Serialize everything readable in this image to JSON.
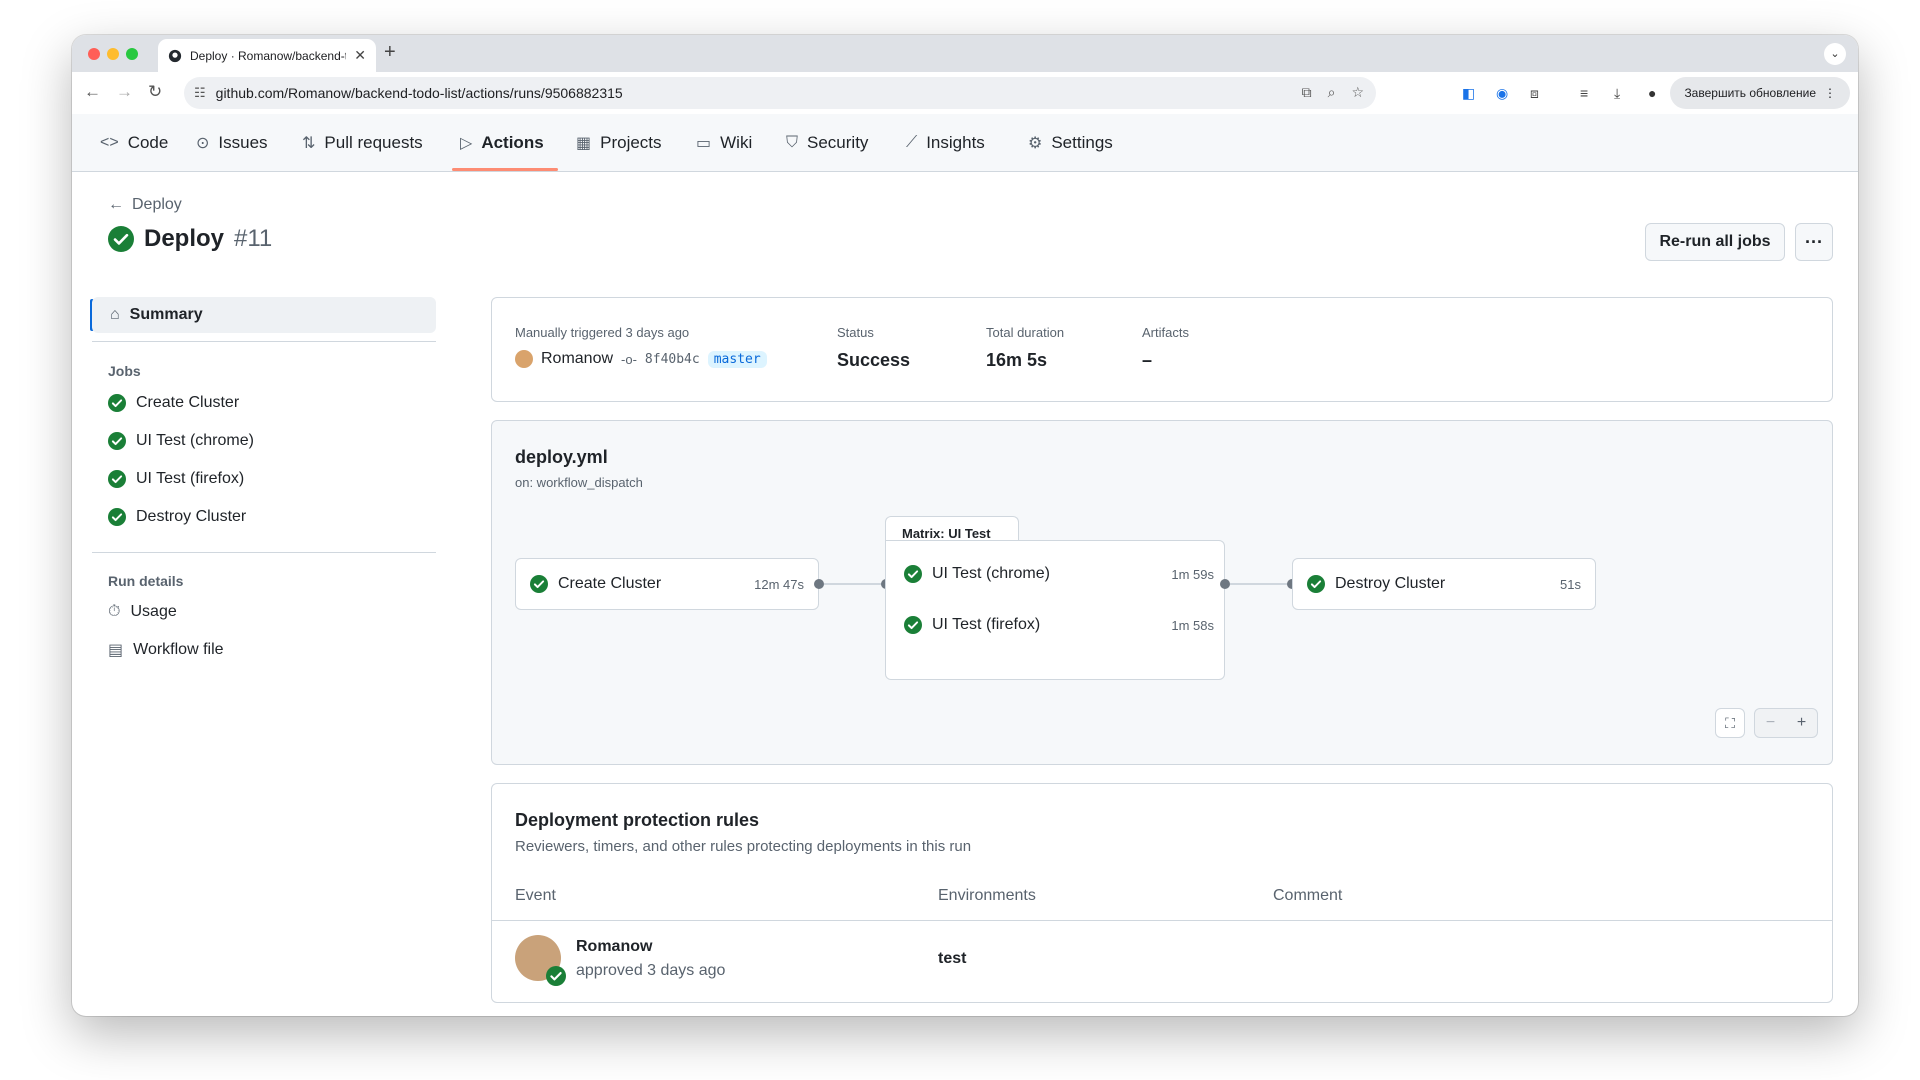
{
  "browser": {
    "tab_title": "Deploy · Romanow/backend-t",
    "url": "github.com/Romanow/backend-todo-list/actions/runs/9506882315",
    "update_button": "Завершить обновление"
  },
  "repo_nav": {
    "tabs": [
      {
        "label": "Code"
      },
      {
        "label": "Issues"
      },
      {
        "label": "Pull requests"
      },
      {
        "label": "Actions"
      },
      {
        "label": "Projects"
      },
      {
        "label": "Wiki"
      },
      {
        "label": "Security"
      },
      {
        "label": "Insights"
      },
      {
        "label": "Settings"
      }
    ],
    "active": "Actions"
  },
  "header": {
    "back_label": "Deploy",
    "title": "Deploy",
    "run_number": "#11",
    "rerun_label": "Re-run all jobs",
    "more_label": "···"
  },
  "sidebar": {
    "summary_label": "Summary",
    "jobs_heading": "Jobs",
    "jobs": [
      "Create Cluster",
      "UI Test (chrome)",
      "UI Test (firefox)",
      "Destroy Cluster"
    ],
    "run_details_heading": "Run details",
    "usage_label": "Usage",
    "workflow_file_label": "Workflow file"
  },
  "summary": {
    "trigger_label": "Manually triggered 3 days ago",
    "user": "Romanow",
    "commit": "8f40b4c",
    "branch": "master",
    "status_label": "Status",
    "status_value": "Success",
    "duration_label": "Total duration",
    "duration_value": "16m 5s",
    "artifacts_label": "Artifacts",
    "artifacts_value": "–"
  },
  "workflow": {
    "file": "deploy.yml",
    "trigger": "on: workflow_dispatch",
    "matrix_label": "Matrix: UI Test",
    "create": {
      "name": "Create Cluster",
      "duration": "12m 47s"
    },
    "chrome": {
      "name": "UI Test (chrome)",
      "duration": "1m 59s"
    },
    "firefox": {
      "name": "UI Test (firefox)",
      "duration": "1m 58s"
    },
    "destroy": {
      "name": "Destroy Cluster",
      "duration": "51s"
    }
  },
  "protection": {
    "title": "Deployment protection rules",
    "subtitle": "Reviewers, timers, and other rules protecting deployments in this run",
    "columns": [
      "Event",
      "Environments",
      "Comment"
    ],
    "row": {
      "user": "Romanow",
      "action": "approved 3 days ago",
      "environment": "test",
      "comment": ""
    }
  },
  "colors": {
    "success": "#1a7f37",
    "accent": "#0969da",
    "active_underline": "#fd8c73"
  }
}
